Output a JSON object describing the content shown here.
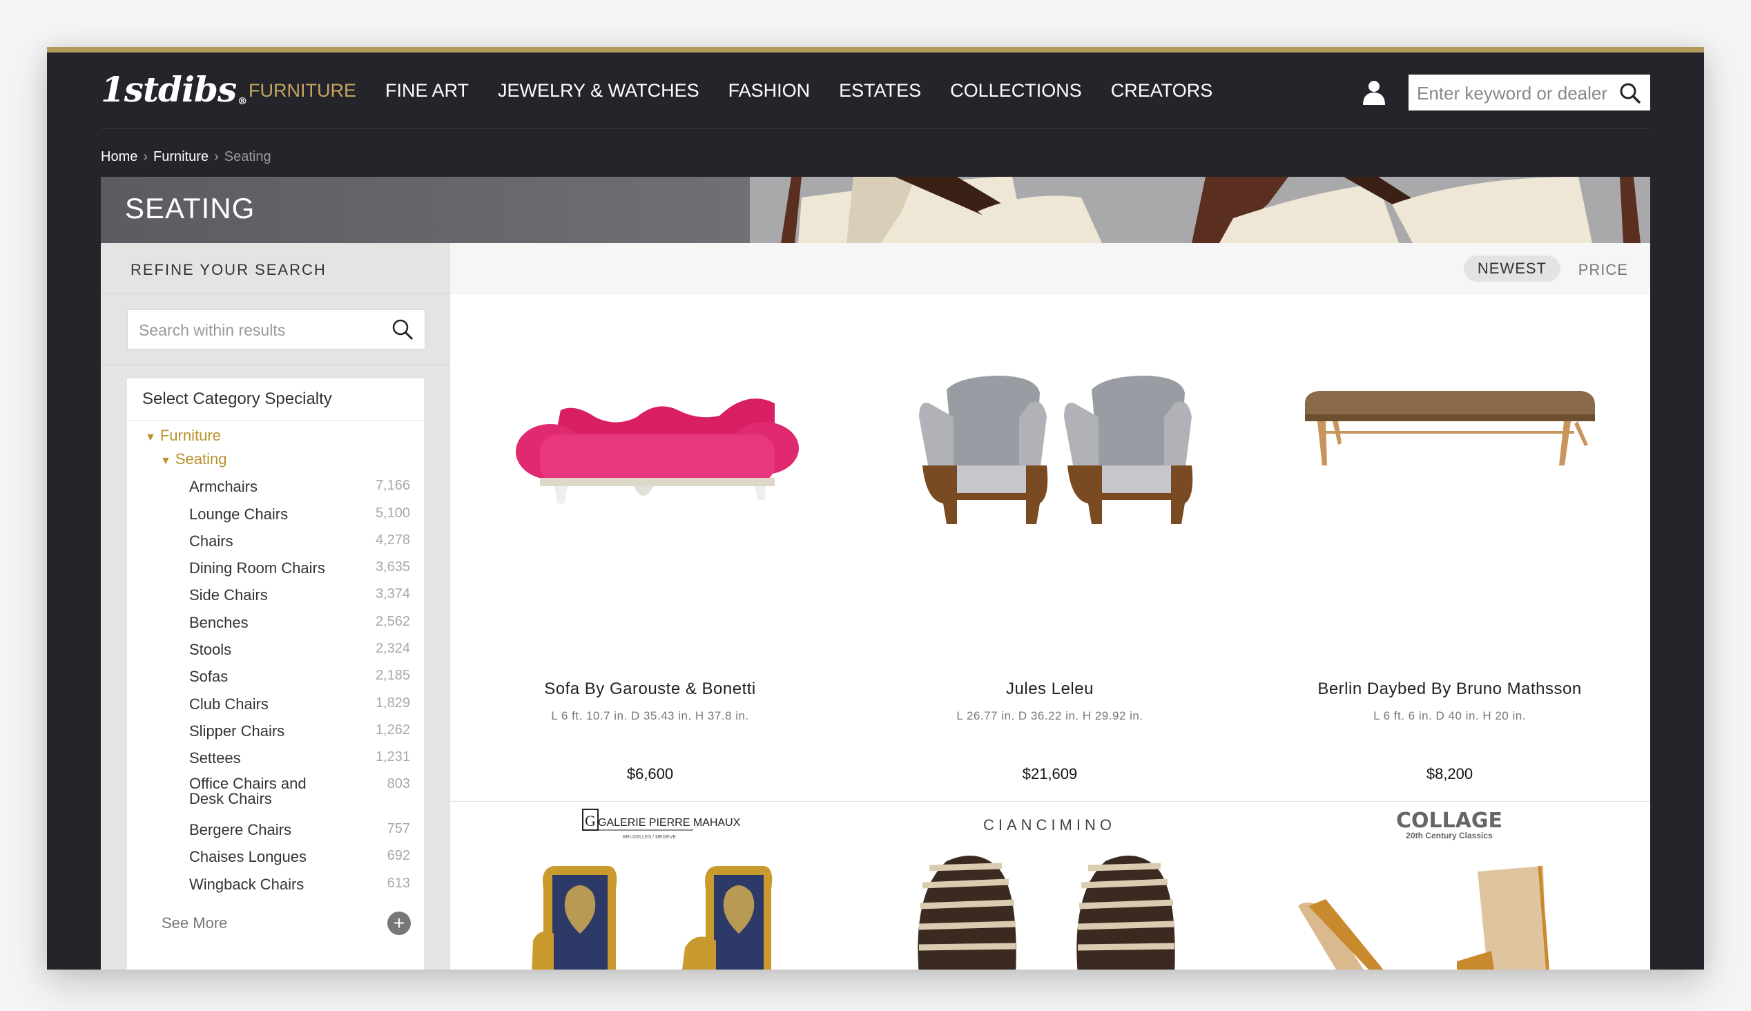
{
  "header": {
    "logo": "1stdibs",
    "logo_mark": "®",
    "nav": [
      {
        "label": "FURNITURE",
        "active": true
      },
      {
        "label": "FINE ART",
        "active": false
      },
      {
        "label": "JEWELRY & WATCHES",
        "active": false
      },
      {
        "label": "FASHION",
        "active": false
      },
      {
        "label": "ESTATES",
        "active": false
      },
      {
        "label": "COLLECTIONS",
        "active": false
      },
      {
        "label": "CREATORS",
        "active": false
      }
    ],
    "search_placeholder": "Enter keyword or dealer"
  },
  "breadcrumb": {
    "home": "Home",
    "furniture": "Furniture",
    "current": "Seating"
  },
  "hero": {
    "title": "SEATING"
  },
  "sidebar": {
    "refine_label": "REFINE YOUR SEARCH",
    "within_placeholder": "Search within results",
    "category_title": "Select Category Specialty",
    "tree_level1": "Furniture",
    "tree_level2": "Seating",
    "categories": [
      {
        "label": "Armchairs",
        "count": "7,166"
      },
      {
        "label": "Lounge Chairs",
        "count": "5,100"
      },
      {
        "label": "Chairs",
        "count": "4,278"
      },
      {
        "label": "Dining Room Chairs",
        "count": "3,635"
      },
      {
        "label": "Side Chairs",
        "count": "3,374"
      },
      {
        "label": "Benches",
        "count": "2,562"
      },
      {
        "label": "Stools",
        "count": "2,324"
      },
      {
        "label": "Sofas",
        "count": "2,185"
      },
      {
        "label": "Club Chairs",
        "count": "1,829"
      },
      {
        "label": "Slipper Chairs",
        "count": "1,262"
      },
      {
        "label": "Settees",
        "count": "1,231"
      },
      {
        "label": "Office Chairs and",
        "label2": "Desk Chairs",
        "count": "803"
      },
      {
        "label": "Bergere Chairs",
        "count": "757"
      },
      {
        "label": "Chaises Longues",
        "count": "692"
      },
      {
        "label": "Wingback Chairs",
        "count": "613"
      }
    ],
    "see_more": "See More",
    "plus": "+"
  },
  "sort": {
    "newest": "NEWEST",
    "price": "PRICE"
  },
  "products": [
    {
      "title": "Sofa By Garouste & Bonetti",
      "dims": "L 6 ft. 10.7 in. D 35.43 in. H 37.8 in.",
      "price": "$6,600",
      "dealer": "GALERIE PIERRE MAHAUX",
      "dealer_sub": "BRUXELLES / MEGEVE",
      "dealer_initial": "G"
    },
    {
      "title": "Jules Leleu",
      "dims": "L 26.77 in. D 36.22 in. H 29.92 in.",
      "price": "$21,609",
      "dealer": "CIANCIMINO"
    },
    {
      "title": "Berlin Daybed By Bruno Mathsson",
      "dims": "L 6 ft. 6 in. D 40 in. H 20 in.",
      "price": "$8,200",
      "dealer": "COLLAGE",
      "dealer_sub": "20th Century Classics"
    }
  ],
  "colors": {
    "accent": "#b9922b",
    "frame": "#23252b",
    "sofa": "#e0296f"
  }
}
